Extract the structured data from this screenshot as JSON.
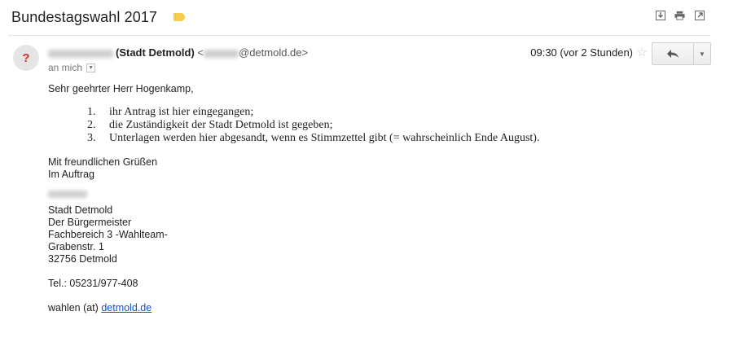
{
  "subject": "Bundestagswahl 2017",
  "label_color": "#f7cb4d",
  "header_icons": [
    "download-icon",
    "print-icon",
    "new-window-icon"
  ],
  "sender": {
    "org": "(Stadt Detmold)",
    "email_prefix": "<",
    "email_domain": "@detmold.de>"
  },
  "recipient_label": "an mich",
  "time": "09:30 (vor 2 Stunden)",
  "body": {
    "greeting": "Sehr geehrter Herr Hogenkamp,",
    "list": [
      {
        "num": "1.",
        "text": "ihr Antrag ist hier eingegangen;"
      },
      {
        "num": "2.",
        "text": "die Zuständigkeit der Stadt Detmold ist gegeben;"
      },
      {
        "num": "3.",
        "text": "Unterlagen werden hier abgesandt, wenn es Stimmzettel gibt (= wahrscheinlich Ende August)."
      }
    ],
    "closing1": "Mit freundlichen Grüßen",
    "closing2": "Im Auftrag",
    "sig_org": "Stadt Detmold",
    "sig_title": "Der Bürgermeister",
    "sig_dept": "Fachbereich 3 -Wahlteam-",
    "sig_street": "Grabenstr. 1",
    "sig_city": "32756 Detmold",
    "tel": "Tel.: 05231/977-408",
    "email_prefix": "wahlen (at) ",
    "email_link": "detmold.de"
  }
}
